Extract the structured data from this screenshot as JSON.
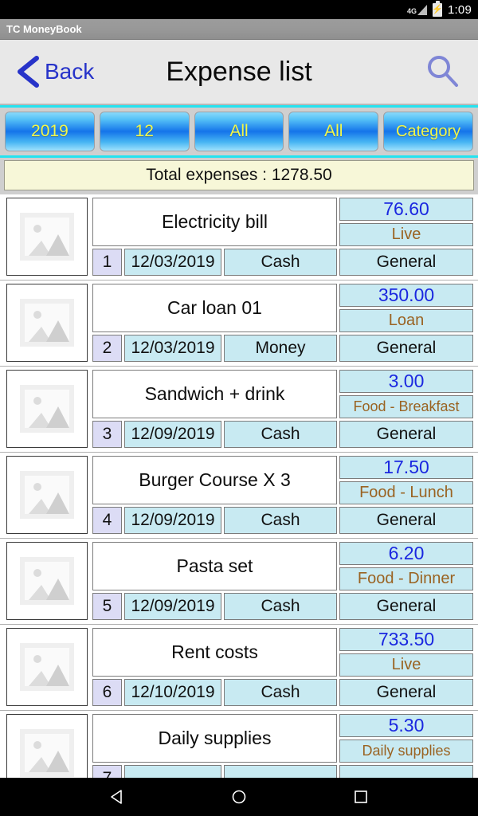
{
  "status_bar": {
    "network_label": "4G",
    "network_icon": "signal-triangle-icon",
    "battery_icon": "battery-charging-icon",
    "battery_glyph": "⚡",
    "time": "1:09"
  },
  "app_bar": {
    "app_name": "TC MoneyBook"
  },
  "header": {
    "back_label": "Back",
    "back_icon": "chevron-left-icon",
    "title": "Expense list",
    "search_icon": "search-icon"
  },
  "filters": [
    {
      "name": "year",
      "label": "2019"
    },
    {
      "name": "month",
      "label": "12"
    },
    {
      "name": "payment",
      "label": "All"
    },
    {
      "name": "account",
      "label": "All"
    },
    {
      "name": "category",
      "label": "Category"
    }
  ],
  "summary": {
    "total_label": "Total expenses : 1278.50"
  },
  "list": {
    "thumbnail_icon": "image-placeholder-icon",
    "rows": [
      {
        "index": "1",
        "name": "Electricity bill",
        "amount": "76.60",
        "category": "Live",
        "date": "12/03/2019",
        "payment": "Cash",
        "account": "General"
      },
      {
        "index": "2",
        "name": "Car loan 01",
        "amount": "350.00",
        "category": "Loan",
        "date": "12/03/2019",
        "payment": "Money",
        "account": "General"
      },
      {
        "index": "3",
        "name": "Sandwich + drink",
        "amount": "3.00",
        "category": "Food - Breakfast",
        "date": "12/09/2019",
        "payment": "Cash",
        "account": "General"
      },
      {
        "index": "4",
        "name": "Burger Course X 3",
        "amount": "17.50",
        "category": "Food - Lunch",
        "date": "12/09/2019",
        "payment": "Cash",
        "account": "General"
      },
      {
        "index": "5",
        "name": "Pasta set",
        "amount": "6.20",
        "category": "Food - Dinner",
        "date": "12/09/2019",
        "payment": "Cash",
        "account": "General"
      },
      {
        "index": "6",
        "name": "Rent costs",
        "amount": "733.50",
        "category": "Live",
        "date": "12/10/2019",
        "payment": "Cash",
        "account": "General"
      },
      {
        "index": "7",
        "name": "Daily supplies",
        "amount": "5.30",
        "category": "Daily supplies",
        "date": "",
        "payment": "",
        "account": ""
      }
    ]
  },
  "nav_bar": {
    "back_icon": "nav-back-triangle-icon",
    "home_icon": "nav-home-circle-icon",
    "recents_icon": "nav-recents-square-icon"
  },
  "colors": {
    "accent_cyan": "#25e3f0",
    "button_blue": "#1474ea",
    "button_text_yellow": "#f2f74a",
    "amount_blue": "#1a27e0",
    "category_brown": "#9a6322",
    "cell_cyan": "#c8eaf2",
    "index_lavender": "#dcdcf5",
    "total_bg": "#f7f7d8"
  }
}
